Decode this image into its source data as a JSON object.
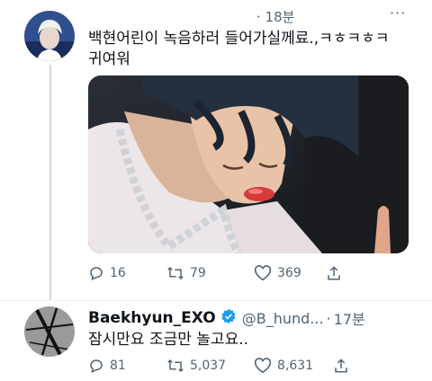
{
  "tweet1": {
    "time": "· 18분",
    "text_line1": "백현어린이 녹음하러 들어가실께료.,ㅋㅎㅋㅎㅋ",
    "text_line2": "귀여워",
    "actions": {
      "replies": "16",
      "retweets": "79",
      "likes": "369"
    }
  },
  "tweet2": {
    "display_name": "Baekhyun_EXO",
    "handle": "@B_hund...",
    "time": "17분",
    "text": "잠시만요 조금만 놀고요..",
    "actions": {
      "replies": "81",
      "retweets": "5,037",
      "likes": "8,631"
    }
  },
  "colors": {
    "verified": "#1d9bf0",
    "muted": "#536471",
    "text": "#0f1419"
  }
}
